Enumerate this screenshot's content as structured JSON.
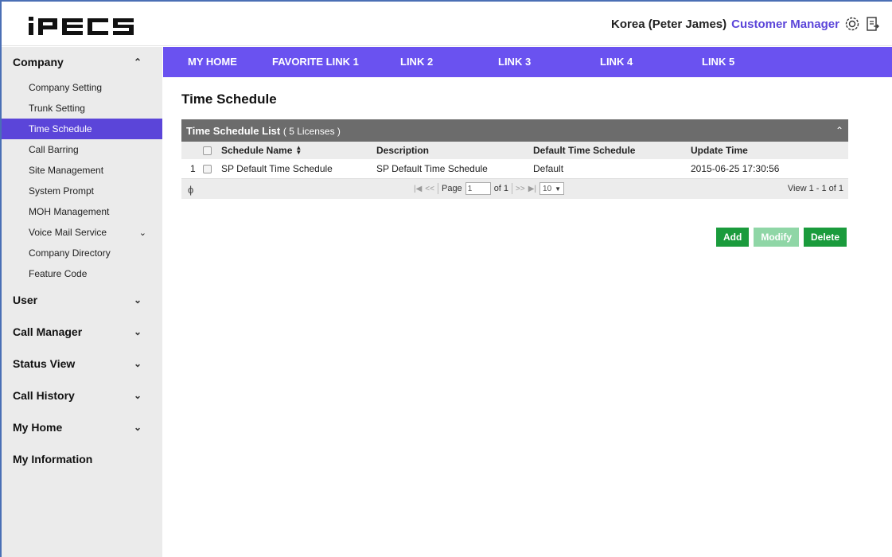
{
  "header": {
    "logo": "iPECS",
    "user": "Korea (Peter James)",
    "role": "Customer Manager",
    "icons": [
      "settings-icon",
      "logout-icon"
    ]
  },
  "nav": {
    "links": [
      "MY HOME",
      "FAVORITE LINK 1",
      "LINK 2",
      "LINK 3",
      "LINK 4",
      "LINK 5"
    ]
  },
  "sidebar": {
    "company": {
      "label": "Company",
      "expanded": true,
      "items": [
        {
          "label": "Company Setting"
        },
        {
          "label": "Trunk Setting"
        },
        {
          "label": "Time Schedule",
          "active": true
        },
        {
          "label": "Call Barring"
        },
        {
          "label": "Site Management"
        },
        {
          "label": "System Prompt"
        },
        {
          "label": "MOH Management"
        },
        {
          "label": "Voice Mail Service",
          "has_children": true
        },
        {
          "label": "Company Directory"
        },
        {
          "label": "Feature Code"
        }
      ]
    },
    "groups": [
      "User",
      "Call Manager",
      "Status View",
      "Call History",
      "My Home",
      "My Information"
    ]
  },
  "main": {
    "title": "Time Schedule",
    "panel": {
      "title": "Time Schedule List",
      "licenses": "( 5 Licenses )",
      "columns": [
        "Schedule Name",
        "Description",
        "Default Time Schedule",
        "Update Time"
      ],
      "rows": [
        {
          "num": "1",
          "name": "SP Default Time Schedule",
          "description": "SP Default Time Schedule",
          "default": "Default",
          "updated": "2015-06-25 17:30:56"
        }
      ],
      "pager": {
        "page_label": "Page",
        "page_value": "1",
        "of_label": "of 1",
        "rows_per_page": "10",
        "view": "View 1 - 1 of 1"
      }
    },
    "buttons": {
      "add": "Add",
      "modify": "Modify",
      "delete": "Delete"
    }
  },
  "colors": {
    "accent": "#6a52f0",
    "active_item": "#5b45d9",
    "button": "#1a9b3c",
    "button_disabled": "#8fd6a6",
    "panel_header": "#6c6c6c"
  }
}
